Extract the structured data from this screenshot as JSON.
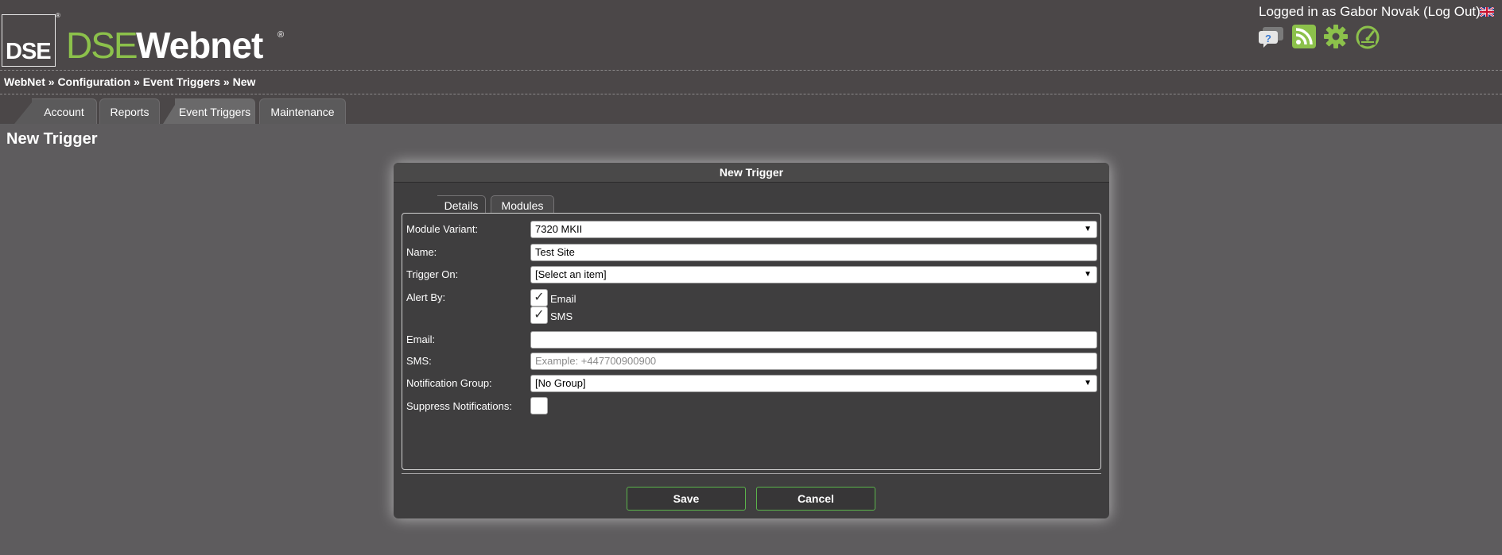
{
  "header": {
    "logo_box_text": "DSE",
    "logo_reg": "®",
    "logo_dse": "DSE",
    "logo_webnet": "Webnet",
    "logged_in_prefix": "Logged in as Gabor Novak ",
    "logout_label": "(Log Out)"
  },
  "icons": {
    "help": "help-icon",
    "rss": "rss-icon",
    "settings": "gear-icon",
    "dashboard": "gauge-icon",
    "language": "uk-flag-icon"
  },
  "breadcrumb": {
    "items": [
      "WebNet",
      "Configuration",
      "Event Triggers",
      "New"
    ],
    "separator": " » "
  },
  "nav": {
    "tabs": [
      {
        "label": "Account"
      },
      {
        "label": "Reports"
      },
      {
        "label": "Event Triggers"
      },
      {
        "label": "Maintenance"
      }
    ],
    "active": "Event Triggers"
  },
  "page": {
    "title": "New Trigger"
  },
  "dialog": {
    "title": "New Trigger",
    "tabs": [
      {
        "label": "Details"
      },
      {
        "label": "Modules"
      }
    ],
    "active_tab": "Details",
    "fields": {
      "module_variant": {
        "label": "Module Variant:",
        "value": "7320 MKII"
      },
      "name": {
        "label": "Name:",
        "value": "Test Site"
      },
      "trigger_on": {
        "label": "Trigger On:",
        "value": "[Select an item]"
      },
      "alert_by": {
        "label": "Alert By:",
        "options": [
          {
            "label": "Email",
            "checked": true
          },
          {
            "label": "SMS",
            "checked": true
          }
        ]
      },
      "email": {
        "label": "Email:",
        "value": ""
      },
      "sms": {
        "label": "SMS:",
        "value": "",
        "placeholder": "Example: +447700900900"
      },
      "notification_group": {
        "label": "Notification Group:",
        "value": "[No Group]"
      },
      "suppress_notifications": {
        "label": "Suppress Notifications:",
        "checked": false
      }
    },
    "buttons": {
      "save": "Save",
      "cancel": "Cancel"
    }
  },
  "colors": {
    "brand_green": "#8cc14b",
    "header_bg": "#4b4748",
    "page_bg": "#5e5c5e",
    "dialog_bg": "#3f3e3f",
    "button_border": "#5bb54b"
  },
  "glyphs": {
    "check": "✓",
    "arrow": "▼"
  }
}
